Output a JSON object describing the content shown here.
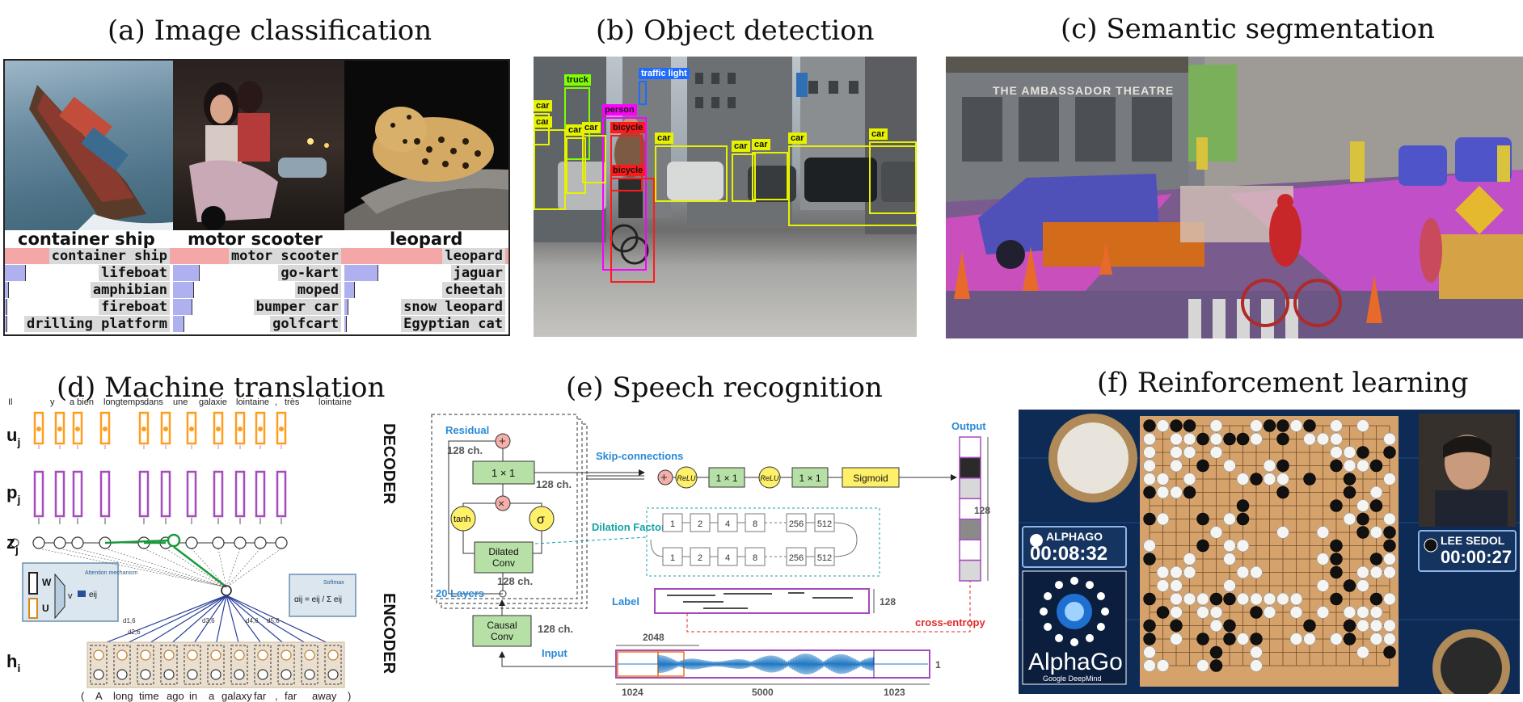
{
  "titles": {
    "a": "(a) Image classification",
    "b": "(b) Object detection",
    "c": "(c) Semantic segmentation",
    "d": "(d) Machine translation",
    "e": "(e) Speech recognition",
    "f": "(f) Reinforcement learning"
  },
  "classification": {
    "columns": [
      {
        "label": "container ship",
        "preds": [
          "container ship",
          "lifeboat",
          "amphibian",
          "fireboat",
          "drilling platform"
        ],
        "scores": [
          1.0,
          0.12,
          0.02,
          0.01,
          0.01
        ]
      },
      {
        "label": "motor scooter",
        "preds": [
          "motor scooter",
          "go-kart",
          "moped",
          "bumper car",
          "golfcart"
        ],
        "scores": [
          1.0,
          0.15,
          0.12,
          0.11,
          0.06
        ]
      },
      {
        "label": "leopard",
        "preds": [
          "leopard",
          "jaguar",
          "cheetah",
          "snow leopard",
          "Egyptian cat"
        ],
        "scores": [
          1.0,
          0.2,
          0.06,
          0.02,
          0.01
        ]
      }
    ]
  },
  "detection": {
    "labels": [
      "truck",
      "traffic light",
      "person",
      "bicycle",
      "bicycle",
      "car",
      "car",
      "car",
      "car",
      "car",
      "car",
      "car",
      "car",
      "car"
    ],
    "colors": {
      "truck": "#7fff00",
      "traffic_light": "#1e6bff",
      "person": "#ff00ff",
      "bicycle": "#ff1a1a",
      "car": "#e6f200"
    }
  },
  "segmentation": {
    "sign": "THE AMBASSADOR THEATRE"
  },
  "translation": {
    "target_words": [
      "Il",
      "y",
      "a bien",
      "longtemps",
      "dans",
      "une",
      "galaxie",
      "lointaine",
      ",",
      "très",
      "lointaine"
    ],
    "source_words": [
      "(",
      "A",
      "long",
      "time",
      "ago",
      "in",
      "a",
      "galaxy",
      "far",
      ",",
      "far",
      "away",
      ")"
    ],
    "row_labels": {
      "u": "u",
      "p": "p",
      "z": "z",
      "h": "h"
    },
    "row_subs": {
      "u": "j",
      "p": "j",
      "z": "j",
      "h": "i"
    },
    "decoder": "DECODER",
    "encoder": "ENCODER",
    "attention_label": "Attention mechanism",
    "softmax_label": "Softmax",
    "alpha_formula": "αij = eij / Σ eij",
    "wa": "W",
    "ua": "U",
    "va": "v",
    "eij": "eij",
    "d_labels": [
      "d1,6",
      "d2,6",
      "d3,6",
      "d4,6",
      "d5,6"
    ]
  },
  "speech": {
    "residual": "Residual",
    "ch128": "128 ch.",
    "conv1x1": "1 × 1",
    "tanh": "tanh",
    "sigma": "σ",
    "dilated_conv": "Dilated\nConv",
    "layers": "20 Layers",
    "skip": "Skip-connections",
    "relu": "ReLU",
    "sigmoid": "Sigmoid",
    "output": "Output",
    "dilation_factors": "Dilation Factors",
    "dilations_row": [
      "1",
      "2",
      "4",
      "8",
      "256",
      "512"
    ],
    "label": "Label",
    "cross_entropy": "cross-entropy",
    "causal_conv": "Causal\nConv",
    "input": "Input",
    "dim_2048": "2048",
    "dim_1024": "1024",
    "dim_5000": "5000",
    "dim_1023": "1023",
    "dim_128_out": "128",
    "dim_128_label": "128",
    "dim_1": "1",
    "output_cells": [
      "#ffffff",
      "#2a2a2a",
      "#d8d8d8",
      "#ffffff",
      "#8a8a8a",
      "#ffffff",
      "#d8d8d8"
    ]
  },
  "rl": {
    "alphago": "ALPHAGO",
    "alphago_time": "00:08:32",
    "lee": "LEE SEDOL",
    "lee_time": "00:00:27",
    "logo_text": "AlphaGo",
    "logo_sub": "Google DeepMind"
  },
  "colors": {
    "orange": "#ff9d1e",
    "purple": "#a64bbd",
    "green_box": "#b7e0a6",
    "yellow_circle": "#fff06a",
    "blue_text": "#2a8ad6",
    "teal": "#15a3a3",
    "red": "#e12b2b"
  }
}
